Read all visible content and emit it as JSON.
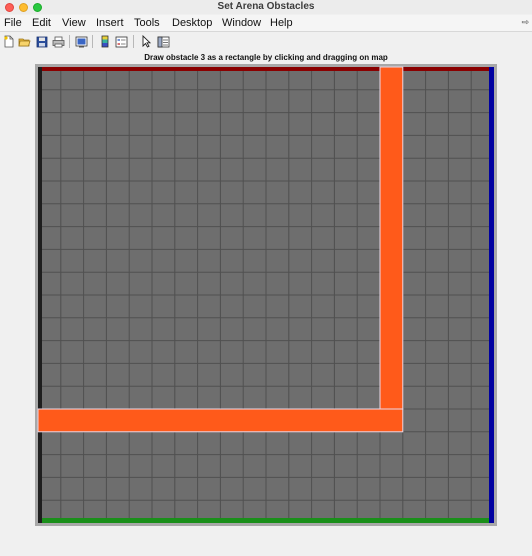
{
  "window": {
    "title": "Set Arena Obstacles"
  },
  "menu": {
    "items": [
      "File",
      "Edit",
      "View",
      "Insert",
      "Tools",
      "Desktop",
      "Window",
      "Help"
    ],
    "overflow_icon": "chevron-right-icon"
  },
  "toolbar": {
    "buttons": [
      {
        "name": "new-figure-icon"
      },
      {
        "name": "open-file-icon"
      },
      {
        "name": "save-icon"
      },
      {
        "name": "print-icon"
      },
      {
        "name": "print-preview-icon"
      },
      {
        "name": "insert-colorbar-icon"
      },
      {
        "name": "insert-legend-icon"
      },
      {
        "name": "edit-plot-pointer-icon"
      },
      {
        "name": "property-inspector-icon"
      }
    ]
  },
  "figure": {
    "title": "Draw obstacle 3 as a rectangle by clicking and dragging on map",
    "grid_cells": 20,
    "colors": {
      "background": "#6e6e6e",
      "grid_line": "#505050",
      "obstacle_fill": "#ff5a1a",
      "obstacle_outline": "#e8d8e8",
      "top_edge": "#8a0000",
      "left_edge": "#1e1e1e",
      "right_edge": "#0000a0",
      "bottom_edge": "#1a8f1a"
    },
    "obstacles": [
      {
        "id": 1,
        "x": [
          15,
          16
        ],
        "y": [
          5,
          20
        ]
      },
      {
        "id": 2,
        "x": [
          0,
          16
        ],
        "y": [
          4,
          5
        ]
      }
    ]
  }
}
